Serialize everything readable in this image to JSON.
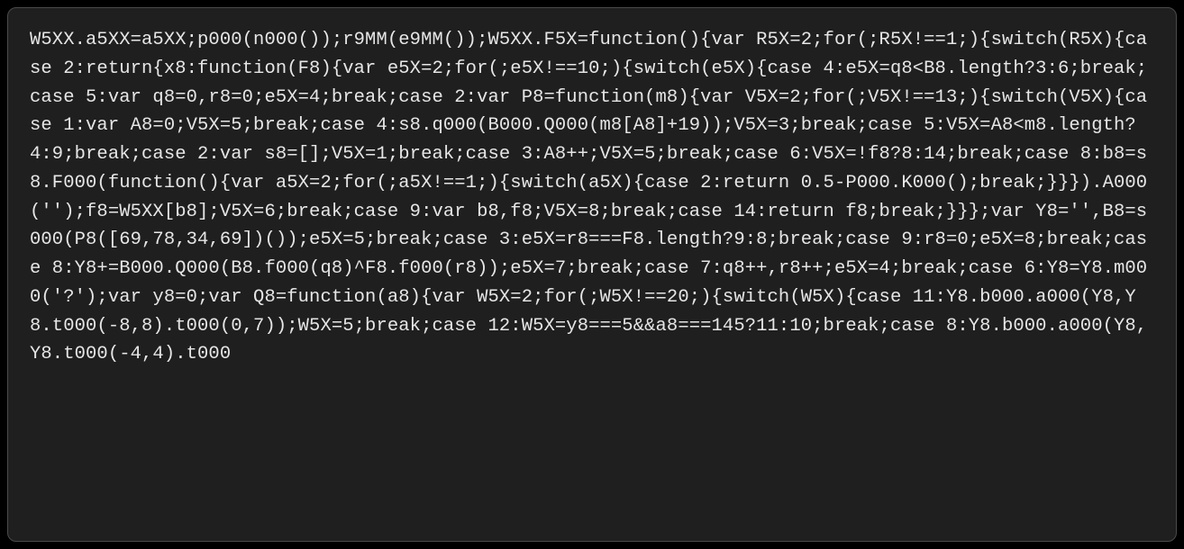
{
  "code": "W5XX.a5XX=a5XX;p000(n000());r9MM(e9MM());W5XX.F5X=function(){var R5X=2;for(;R5X!==1;){switch(R5X){case 2:return{x8:function(F8){var e5X=2;for(;e5X!==10;){switch(e5X){case 4:e5X=q8<B8.length?3:6;break;case 5:var q8=0,r8=0;e5X=4;break;case 2:var P8=function(m8){var V5X=2;for(;V5X!==13;){switch(V5X){case 1:var A8=0;V5X=5;break;case 4:s8.q000(B000.Q000(m8[A8]+19));V5X=3;break;case 5:V5X=A8<m8.length?4:9;break;case 2:var s8=[];V5X=1;break;case 3:A8++;V5X=5;break;case 6:V5X=!f8?8:14;break;case 8:b8=s8.F000(function(){var a5X=2;for(;a5X!==1;){switch(a5X){case 2:return 0.5-P000.K000();break;}}}).A000('');f8=W5XX[b8];V5X=6;break;case 9:var b8,f8;V5X=8;break;case 14:return f8;break;}}};var Y8='',B8=s000(P8([69,78,34,69])());e5X=5;break;case 3:e5X=r8===F8.length?9:8;break;case 9:r8=0;e5X=8;break;case 8:Y8+=B000.Q000(B8.f000(q8)^F8.f000(r8));e5X=7;break;case 7:q8++,r8++;e5X=4;break;case 6:Y8=Y8.m000('?');var y8=0;var Q8=function(a8){var W5X=2;for(;W5X!==20;){switch(W5X){case 11:Y8.b000.a000(Y8,Y8.t000(-8,8).t000(0,7));W5X=5;break;case 12:W5X=y8===5&&a8===145?11:10;break;case 8:Y8.b000.a000(Y8,Y8.t000(-4,4).t000"
}
